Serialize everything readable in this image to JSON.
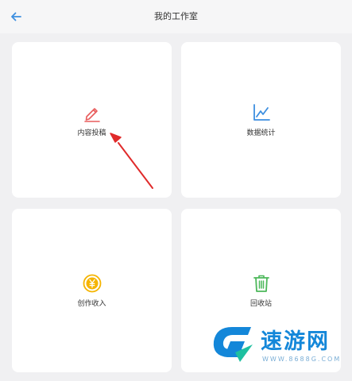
{
  "header": {
    "title": "我的工作室",
    "back_icon": "arrow-left-icon"
  },
  "cards": [
    {
      "label": "内容投稿",
      "icon": "pencil-icon",
      "color": "#e85c5c"
    },
    {
      "label": "数据统计",
      "icon": "line-chart-icon",
      "color": "#3d8fe0"
    },
    {
      "label": "创作收入",
      "icon": "yen-coin-icon",
      "color": "#f5b400"
    },
    {
      "label": "回收站",
      "icon": "trash-icon",
      "color": "#4cb85a"
    }
  ],
  "watermark": {
    "text": "速游网",
    "url": "WWW.8688G.COM"
  },
  "colors": {
    "background": "#f0f0f2",
    "card": "#ffffff",
    "arrow": "#e02b2b",
    "back_icon": "#3d8fe0",
    "watermark": "#1487d9"
  }
}
